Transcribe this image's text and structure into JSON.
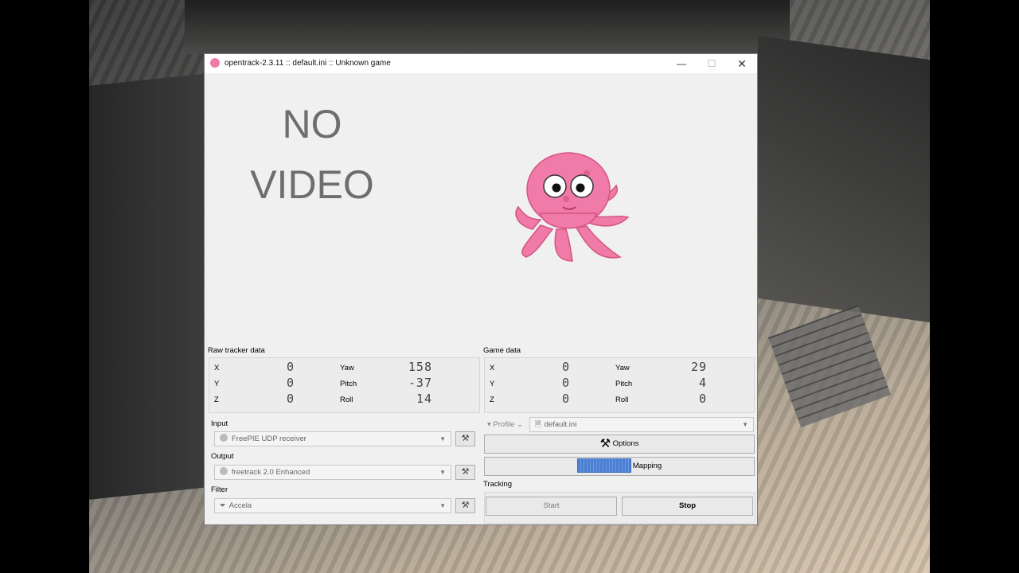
{
  "window": {
    "title": "opentrack-2.3.11 :: default.ini :: Unknown game",
    "minimize_symbol": "—",
    "maximize_symbol": "☐",
    "close_symbol": "✕"
  },
  "video": {
    "line1": "NO",
    "line2": "VIDEO"
  },
  "raw_tracker": {
    "label": "Raw tracker data",
    "x_label": "X",
    "x_value": "0",
    "y_label": "Y",
    "y_value": "0",
    "z_label": "Z",
    "z_value": "0",
    "yaw_label": "Yaw",
    "yaw_value": "158",
    "pitch_label": "Pitch",
    "pitch_value": "-37",
    "roll_label": "Roll",
    "roll_value": "14"
  },
  "game_data": {
    "label": "Game data",
    "x_label": "X",
    "x_value": "0",
    "y_label": "Y",
    "y_value": "0",
    "z_label": "Z",
    "z_value": "0",
    "yaw_label": "Yaw",
    "yaw_value": "29",
    "pitch_label": "Pitch",
    "pitch_value": "4",
    "roll_label": "Roll",
    "roll_value": "0"
  },
  "input": {
    "label": "Input",
    "value": "FreePIE UDP receiver",
    "icon": "freepie-icon"
  },
  "output": {
    "label": "Output",
    "value": "freetrack 2.0 Enhanced",
    "icon": "freetrack-icon"
  },
  "filter": {
    "label": "Filter",
    "value": "Accela",
    "icon": "filter-funnel-icon"
  },
  "profile": {
    "label": "Profile",
    "value": "default.ini"
  },
  "buttons": {
    "options": "Options",
    "mapping": "Mapping",
    "start": "Start",
    "stop": "Stop"
  },
  "tracking": {
    "label": "Tracking"
  },
  "colors": {
    "octopus_pink": "#f07aa8",
    "mapping_blue": "#4a7fd4"
  }
}
